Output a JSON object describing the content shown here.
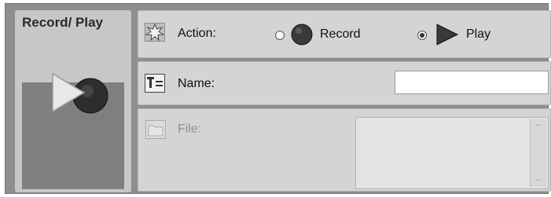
{
  "block": {
    "title": "Record/ Play",
    "icon": "record-play-icon"
  },
  "action_row": {
    "icon": "star-burst-icon",
    "label": "Action:",
    "options": [
      {
        "label": "Record",
        "icon": "record-circle-icon",
        "selected": false
      },
      {
        "label": "Play",
        "icon": "play-triangle-icon",
        "selected": true
      }
    ]
  },
  "name_row": {
    "icon": "text-field-icon",
    "label": "Name:",
    "value": ""
  },
  "file_row": {
    "icon": "folder-icon",
    "label": "File:"
  },
  "colors": {
    "frame": "#8e8e8e",
    "panel": "#d4d4d4",
    "block": "#c7c7c7"
  }
}
